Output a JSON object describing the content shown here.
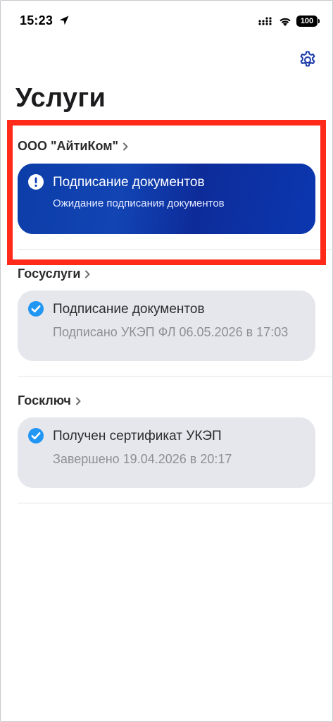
{
  "status_bar": {
    "time": "15:23",
    "battery": "100"
  },
  "header": {
    "title": "Услуги",
    "settings_icon": "gear-icon"
  },
  "sections": [
    {
      "name": "ООО \"АйтиКом\"",
      "card": {
        "title": "Подписание документов",
        "subtitle": "Ожидание подписания документов",
        "status": "alert"
      }
    },
    {
      "name": "Госуслуги",
      "card": {
        "title": "Подписание документов",
        "subtitle": "Подписано УКЭП ФЛ 06.05.2026 в 17:03",
        "status": "done"
      }
    },
    {
      "name": "Госключ",
      "card": {
        "title": "Получен сертификат УКЭП",
        "subtitle": "Завершено 19.04.2026 в 20:17",
        "status": "done"
      }
    }
  ],
  "colors": {
    "accent": "#0a3db2",
    "check": "#2196f3",
    "highlight": "#ff2a1a",
    "card_grey": "#e6e7ec"
  }
}
